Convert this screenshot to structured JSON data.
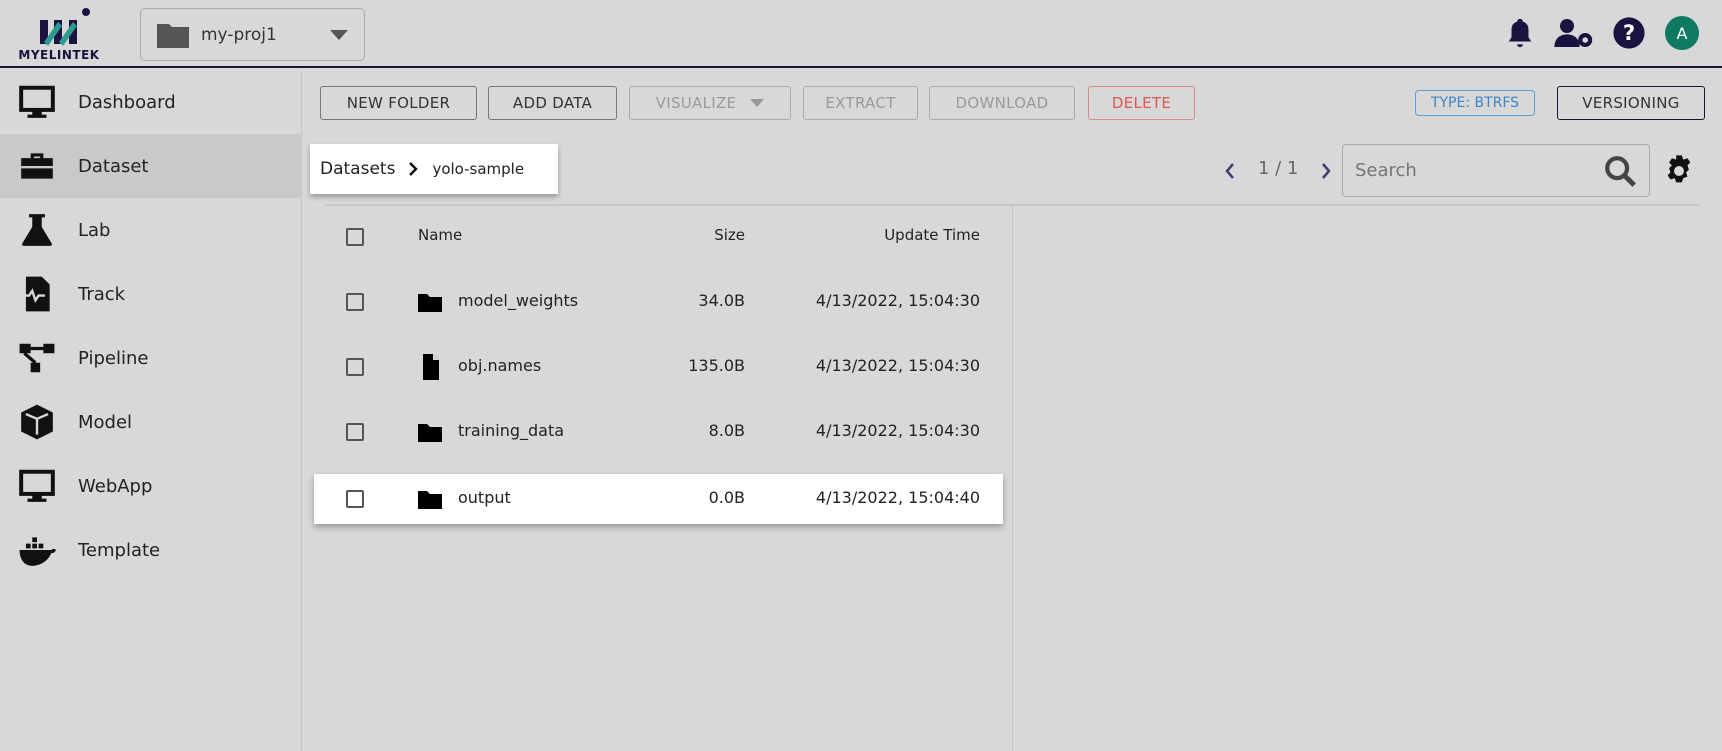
{
  "header": {
    "logo_text": "MYELINTEK",
    "project": "my-proj1",
    "avatar": "A",
    "accent": "#1b1240",
    "avatar_color": "#0f7a63"
  },
  "sidebar": {
    "items": [
      {
        "label": "Dashboard",
        "icon": "monitor-icon"
      },
      {
        "label": "Dataset",
        "icon": "toolbox-icon",
        "active": true
      },
      {
        "label": "Lab",
        "icon": "flask-icon"
      },
      {
        "label": "Track",
        "icon": "file-pulse-icon"
      },
      {
        "label": "Pipeline",
        "icon": "sitemap-icon"
      },
      {
        "label": "Model",
        "icon": "cube-icon"
      },
      {
        "label": "WebApp",
        "icon": "monitor-icon"
      },
      {
        "label": "Template",
        "icon": "docker-icon"
      }
    ]
  },
  "toolbar": {
    "new_folder": "NEW FOLDER",
    "add_data": "ADD DATA",
    "visualize": "VISUALIZE",
    "extract": "EXTRACT",
    "download": "DOWNLOAD",
    "delete": "DELETE",
    "type_badge": "TYPE: BTRFS",
    "versioning": "VERSIONING"
  },
  "breadcrumb": {
    "root": "Datasets",
    "current": "yolo-sample"
  },
  "pagination": {
    "text": "1 / 1"
  },
  "search": {
    "placeholder": "Search"
  },
  "table": {
    "headers": {
      "name": "Name",
      "size": "Size",
      "time": "Update Time"
    },
    "rows": [
      {
        "type": "folder",
        "name": "model_weights",
        "size": "34.0B",
        "time": "4/13/2022, 15:04:30"
      },
      {
        "type": "file",
        "name": "obj.names",
        "size": "135.0B",
        "time": "4/13/2022, 15:04:30"
      },
      {
        "type": "folder",
        "name": "training_data",
        "size": "8.0B",
        "time": "4/13/2022, 15:04:30"
      },
      {
        "type": "folder",
        "name": "output",
        "size": "0.0B",
        "time": "4/13/2022, 15:04:40"
      }
    ]
  }
}
